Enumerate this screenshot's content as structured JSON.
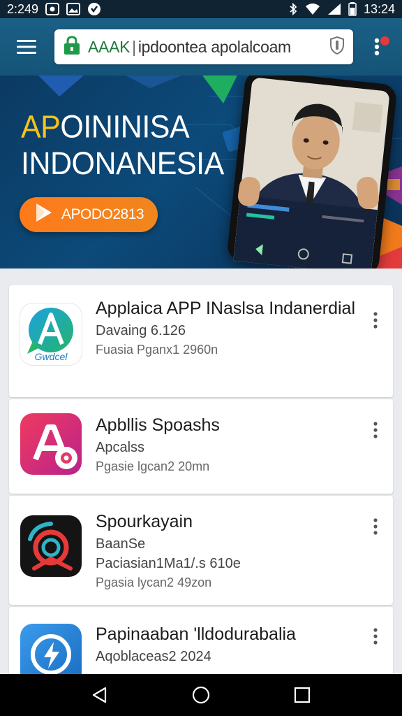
{
  "status_bar": {
    "time_left": "2:249",
    "time_right": "13:24"
  },
  "browser": {
    "url_site": "AAAK",
    "url_separator": "|",
    "url_path": "ipdoontea apolalcoam"
  },
  "hero": {
    "title_accent": "AP",
    "title_line1_rest": "OININISA",
    "title_line2": "INDONANESIA",
    "cta_label": "APODO2813"
  },
  "apps": [
    {
      "title": "Applaica APP INaslsa Indanerdial",
      "subtitle": "Davaing 6.126",
      "meta": "Fuasia Pganx1 2960n",
      "icon": "a-logo-icon",
      "icon_caption": "Gwdcel",
      "colors": [
        "#1aa3e0",
        "#26b36b"
      ]
    },
    {
      "title": "Apbllis Spoashs",
      "subtitle": "Apcalss",
      "meta": "Pgasie lgcan2 20mn",
      "icon": "a-camera-icon",
      "colors": [
        "#f03a5f",
        "#b8238c"
      ]
    },
    {
      "title": "Spourkayain",
      "subtitle": "BaanSe",
      "subtitle2": "Paciasian1Ma1/.s 610e",
      "meta": "Pgasia lycan2 49zon",
      "icon": "record-icon",
      "colors": [
        "#111111",
        "#e63a3a"
      ]
    },
    {
      "title": "Papinaaban 'lldodurabalia",
      "subtitle": "Aqoblaceas2 2024",
      "icon": "lightning-icon",
      "colors": [
        "#2c8be0",
        "#1a6cc0"
      ]
    }
  ]
}
